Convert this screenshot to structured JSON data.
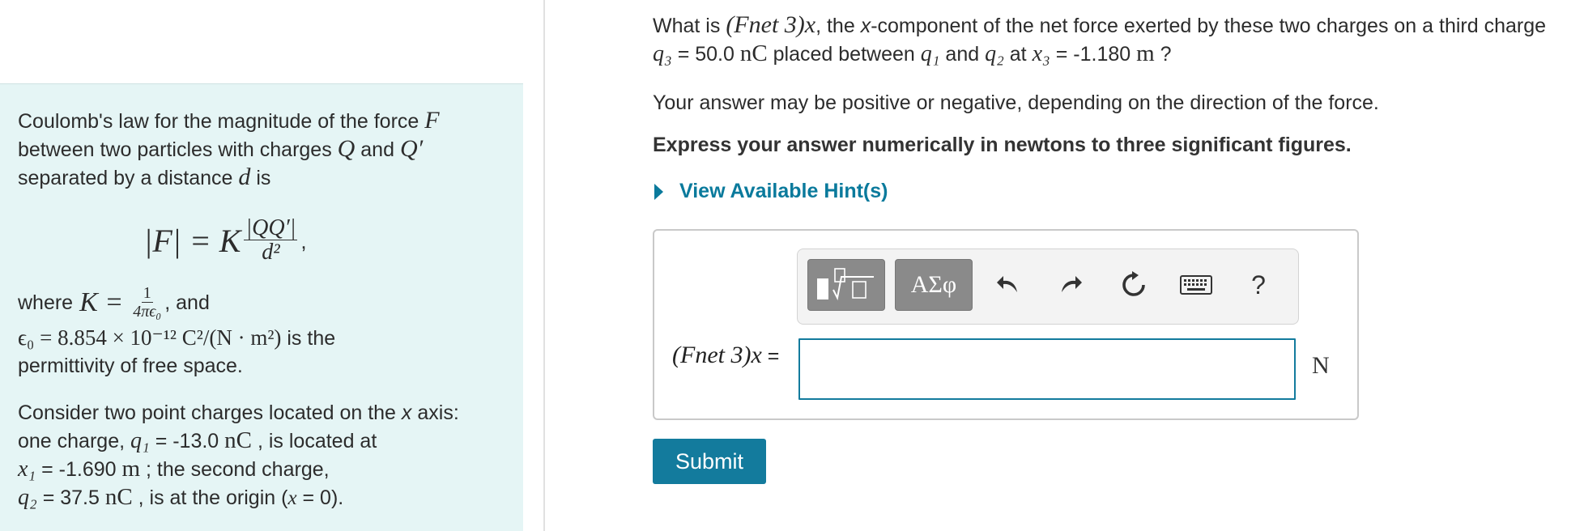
{
  "left_panel": {
    "coulomb_intro_1": "Coulomb's law for the magnitude of the force",
    "coulomb_F": "F",
    "coulomb_intro_2": "between two particles with charges",
    "coulomb_Q": "Q",
    "and_word": "and",
    "coulomb_Qp": "Q′",
    "coulomb_intro_3": "separated by a distance",
    "coulomb_d": "d",
    "is_word": "is",
    "formula_lhs": "|F| = K",
    "formula_num": "|QQ′|",
    "formula_den": "d²",
    "formula_comma": ",",
    "where_word": "where",
    "k_expr": "K =",
    "k_num": "1",
    "k_den": "4πϵ₀",
    "k_suffix": ", and",
    "eps_expr": "ϵ₀ = 8.854 × 10⁻¹² C²/(N · m²)",
    "eps_suffix": "is the",
    "eps_line2": "permittivity of free space.",
    "consider_1": "Consider two point charges located on the",
    "x_word": "x",
    "axis_word": "axis:",
    "consider_2": "one charge,",
    "q1": "q₁",
    "q1_value": "= -13.0",
    "nC": "nC",
    "located_at": ", is located at",
    "x1": "x₁",
    "x1_value": "= -1.690",
    "m_unit": "m",
    "second_charge": "; the second charge,",
    "q2": "q₂",
    "q2_value": "= 37.5",
    "at_origin": ", is at the origin (",
    "x_eq": "x",
    "origin_val": "= 0)."
  },
  "question": {
    "what_is": "What is",
    "fnet_sym": "(Fnet 3)x",
    "q_text_1": ", the",
    "x_comp": "x",
    "q_text_2": "-component of the net force exerted by these two charges on a third charge",
    "q3": "q₃",
    "q3_value": "= 50.0",
    "q3_unit": "nC",
    "placed_between": "placed between",
    "q1": "q₁",
    "and_word": "and",
    "q2": "q₂",
    "at_word": "at",
    "x3": "x₃",
    "x3_value": "= -1.180",
    "x3_unit": "m",
    "qmark": "?"
  },
  "note": "Your answer may be positive or negative, depending on the direction of the force.",
  "express": "Express your answer numerically in newtons to three significant figures.",
  "hints_label": "View Available Hint(s)",
  "toolbar": {
    "greek_label": "ΑΣφ",
    "undo_icon": "undo-icon",
    "redo_icon": "redo-icon",
    "reset_icon": "reset-icon",
    "keyboard_icon": "keyboard-icon",
    "help_label": "?"
  },
  "answer": {
    "label_sym": "(Fnet 3)x",
    "label_eq": "=",
    "value": "",
    "unit": "N"
  },
  "submit_label": "Submit",
  "colors": {
    "accent": "#137b9d",
    "panel_bg": "#e5f5f5",
    "link": "#0a7a9c"
  }
}
